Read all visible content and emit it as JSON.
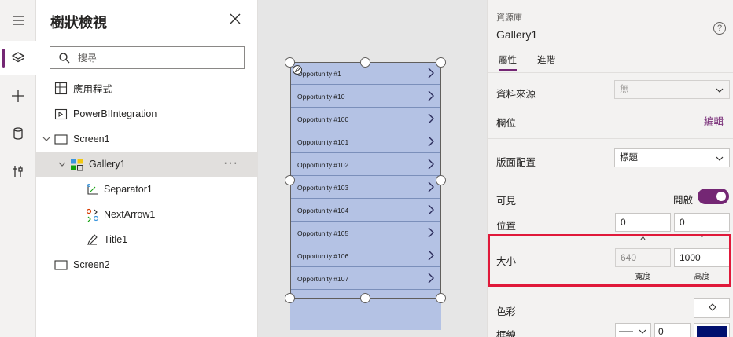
{
  "rail": {
    "items": [
      {
        "icon": "hamburger-menu-icon"
      },
      {
        "icon": "layers-icon",
        "active": true
      },
      {
        "icon": "plus-icon"
      },
      {
        "icon": "database-icon"
      },
      {
        "icon": "tools-icon"
      }
    ]
  },
  "tree": {
    "title": "樹狀檢視",
    "search_placeholder": "搜尋",
    "items": [
      {
        "label": "應用程式",
        "icon": "app-icon"
      },
      {
        "label": "PowerBIIntegration",
        "icon": "powerbi-component-icon"
      },
      {
        "label": "Screen1",
        "icon": "screen-icon"
      },
      {
        "label": "Gallery1",
        "icon": "gallery-icon"
      },
      {
        "label": "Separator1",
        "icon": "separator-icon"
      },
      {
        "label": "NextArrow1",
        "icon": "next-arrow-icon"
      },
      {
        "label": "Title1",
        "icon": "title-icon"
      },
      {
        "label": "Screen2",
        "icon": "screen-icon"
      }
    ],
    "more": "···"
  },
  "gallery": {
    "rows": [
      "Opportunity #1",
      "Opportunity #10",
      "Opportunity #100",
      "Opportunity #101",
      "Opportunity #102",
      "Opportunity #103",
      "Opportunity #104",
      "Opportunity #105",
      "Opportunity #106",
      "Opportunity #107"
    ]
  },
  "props": {
    "category": "資源庫",
    "name": "Gallery1",
    "help": "?",
    "tabs": [
      "屬性",
      "進階"
    ],
    "data_source": {
      "label": "資料來源",
      "value": "無"
    },
    "fields": {
      "label": "欄位",
      "link": "編輯"
    },
    "layout": {
      "label": "版面配置",
      "value": "標題"
    },
    "visible": {
      "label": "可見",
      "state": "開啟"
    },
    "position": {
      "label": "位置",
      "x": "0",
      "y": "0",
      "x_caption": "X",
      "y_caption": "Y"
    },
    "size": {
      "label": "大小",
      "width": "640",
      "height": "1000",
      "width_caption": "寬度",
      "height_caption": "高度"
    },
    "color": {
      "label": "色彩"
    },
    "border": {
      "label": "框線",
      "width": "0",
      "color": "#000f6e"
    }
  },
  "colors": {
    "accent": "#742774",
    "highlight": "#e0193a",
    "gallery_fill": "#b4c2e4"
  }
}
